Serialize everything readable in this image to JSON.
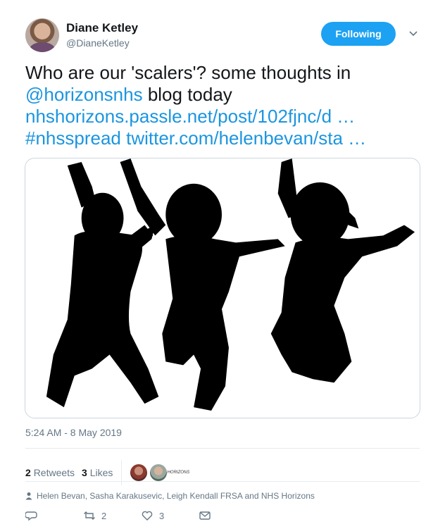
{
  "author": {
    "name": "Diane Ketley",
    "handle": "@DianeKetley"
  },
  "follow_button": "Following",
  "tweet": {
    "line1": "Who are our 'scalers'? some thoughts in",
    "mention": "@horizonsnhs",
    "line2_rest": " blog today",
    "link1": "nhshorizons.passle.net/post/102fjnc/d  …",
    "hashtag": "#nhsspread",
    "link2": "twitter.com/helenbevan/sta …"
  },
  "timestamp": "5:24 AM - 8 May 2019",
  "stats": {
    "retweets_count": "2",
    "retweets_label": "Retweets",
    "likes_count": "3",
    "likes_label": "Likes",
    "third_avatar_label": "HORIZONS"
  },
  "retweeted_by": "Helen Bevan, Sasha Karakusevic, Leigh Kendall FRSA and NHS Horizons",
  "actions": {
    "reply_count": "",
    "retweet_count": "2",
    "like_count": "3"
  },
  "colors": {
    "accent": "#1da1f2",
    "link": "#1b95e0",
    "secondary_text": "#657786"
  },
  "icons": [
    "chevron-down-icon",
    "person-icon",
    "reply-icon",
    "retweet-icon",
    "heart-icon",
    "message-icon"
  ]
}
